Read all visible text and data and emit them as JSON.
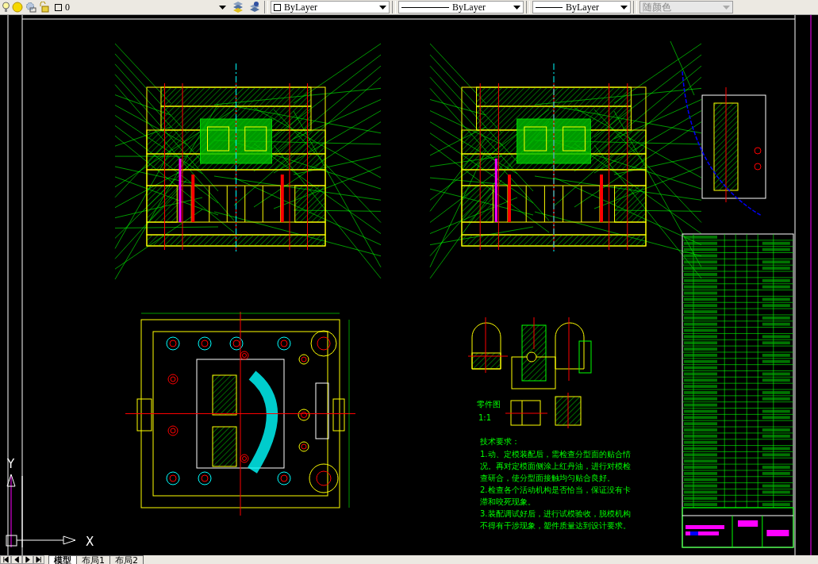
{
  "toolbar": {
    "layer": "0",
    "color_control": "ByLayer",
    "linetype": "ByLayer",
    "lineweight": "ByLayer",
    "plot_style": {
      "value": "随颜色",
      "disabled": true
    }
  },
  "drawing": {
    "part_view": {
      "title": "零件图",
      "scale": "1:1"
    },
    "technical_requirements": {
      "title": "技术要求：",
      "lines": [
        "1.动、定模装配后，需检查分型面的贴合情",
        "况。再对定模面侧涂上红丹油，进行对模检",
        "查研合，使分型面接触均匀贴合良好。",
        "2.检查各个活动机构是否恰当，保证没有卡",
        "滞和咬死现象。",
        "3.装配调试好后，进行试模验收，脱模机构",
        "不得有干涉现象，塑件质量达到设计要求。"
      ]
    },
    "ucs": {
      "x_label": "X",
      "y_label": "Y"
    }
  },
  "tabs": [
    {
      "label": "模型",
      "selected": true
    },
    {
      "label": "布局1",
      "selected": false
    },
    {
      "label": "布局2",
      "selected": false
    }
  ]
}
